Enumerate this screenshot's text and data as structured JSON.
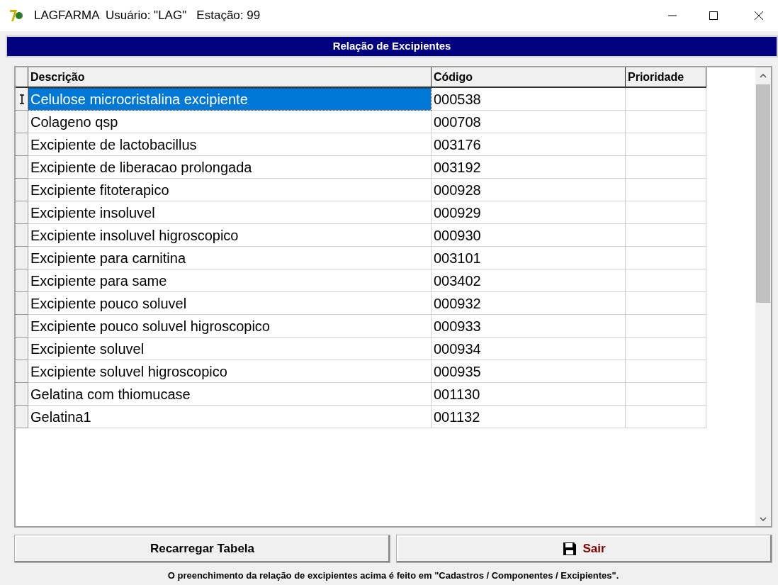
{
  "window": {
    "title": "LAGFARMA  Usuário: \"LAG\"   Estação: 99"
  },
  "panel_title": "Relação de Excipientes",
  "table": {
    "columns": [
      "Descrição",
      "Código",
      "Prioridade"
    ],
    "rows": [
      {
        "cells": [
          "Celulose microcristalina excipiente",
          "000538",
          ""
        ],
        "selected": true
      },
      {
        "cells": [
          "Colageno qsp",
          "000708",
          ""
        ],
        "selected": false
      },
      {
        "cells": [
          "Excipiente de lactobacillus",
          "003176",
          ""
        ],
        "selected": false
      },
      {
        "cells": [
          "Excipiente de liberacao prolongada",
          "003192",
          ""
        ],
        "selected": false
      },
      {
        "cells": [
          "Excipiente fitoterapico",
          "000928",
          ""
        ],
        "selected": false
      },
      {
        "cells": [
          "Excipiente insoluvel",
          "000929",
          ""
        ],
        "selected": false
      },
      {
        "cells": [
          "Excipiente insoluvel higroscopico",
          "000930",
          ""
        ],
        "selected": false
      },
      {
        "cells": [
          "Excipiente para carnitina",
          "003101",
          ""
        ],
        "selected": false
      },
      {
        "cells": [
          "Excipiente para same",
          "003402",
          ""
        ],
        "selected": false
      },
      {
        "cells": [
          "Excipiente pouco soluvel",
          "000932",
          ""
        ],
        "selected": false
      },
      {
        "cells": [
          "Excipiente pouco soluvel higroscopico",
          "000933",
          ""
        ],
        "selected": false
      },
      {
        "cells": [
          "Excipiente soluvel",
          "000934",
          ""
        ],
        "selected": false
      },
      {
        "cells": [
          "Excipiente soluvel higroscopico",
          "000935",
          ""
        ],
        "selected": false
      },
      {
        "cells": [
          "Gelatina com thiomucase",
          "001130",
          ""
        ],
        "selected": false
      },
      {
        "cells": [
          "Gelatina1",
          "001132",
          ""
        ],
        "selected": false
      }
    ]
  },
  "buttons": [
    {
      "label": "Recarregar Tabela",
      "kind": "plain"
    },
    {
      "label": "Sair",
      "kind": "save"
    }
  ],
  "footer": "O preenchimento da relação de excipientes acima é feito em \"Cadastros / Componentes / Excipientes\"."
}
